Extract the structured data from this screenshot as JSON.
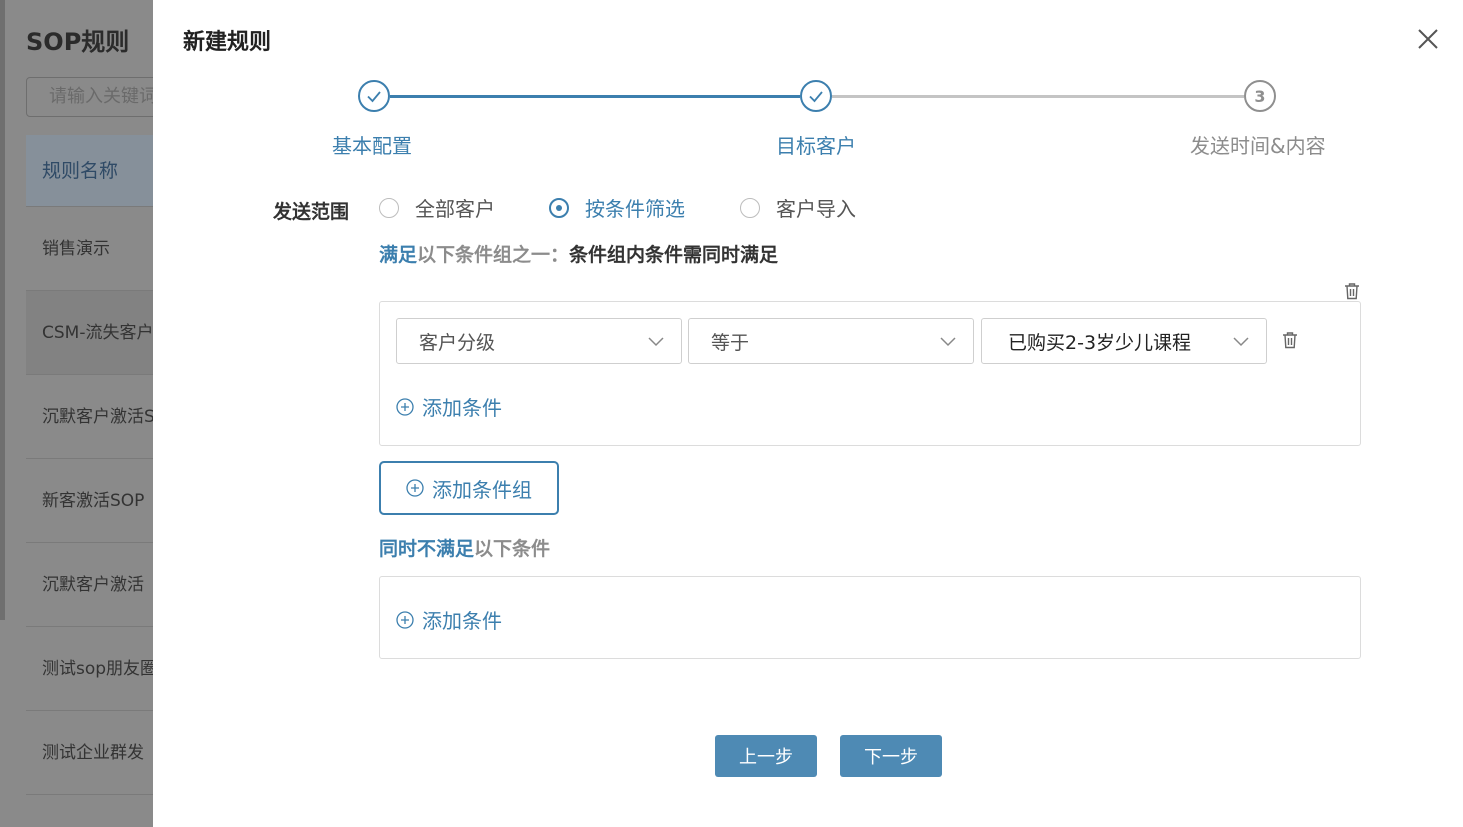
{
  "background": {
    "title": "SOP规则",
    "search_placeholder": "请输入关键词",
    "table_header": "规则名称",
    "rows": [
      "销售演示",
      "CSM-流失客户",
      "沉默客户激活SOP",
      "新客激活SOP",
      "沉默客户激活",
      "测试sop朋友圈",
      "测试企业群发"
    ]
  },
  "drawer": {
    "title": "新建规则",
    "steps": [
      {
        "label": "基本配置",
        "status": "done"
      },
      {
        "label": "目标客户",
        "status": "done"
      },
      {
        "label": "发送时间&内容",
        "status": "wait",
        "number": "3"
      }
    ],
    "send_scope": {
      "label": "发送范围",
      "options": [
        "全部客户",
        "按条件筛选",
        "客户导入"
      ],
      "selected": "按条件筛选"
    },
    "include_hint": {
      "part1": "满足",
      "part2": "以下条件组之一：",
      "part3": "条件组内条件需同时满足"
    },
    "condition_group": {
      "field": "客户分级",
      "operator": "等于",
      "value": "已购买2-3岁少儿课程",
      "add_condition": "添加条件"
    },
    "add_group_label": "添加条件组",
    "exclude_hint": {
      "part1": "同时不满足",
      "part2": "以下条件"
    },
    "exclude_add_condition": "添加条件",
    "buttons": {
      "prev": "上一步",
      "next": "下一步"
    }
  },
  "colors": {
    "primary": "#3c7fae",
    "button": "#4e8ab4",
    "muted": "#8c8c8c"
  }
}
